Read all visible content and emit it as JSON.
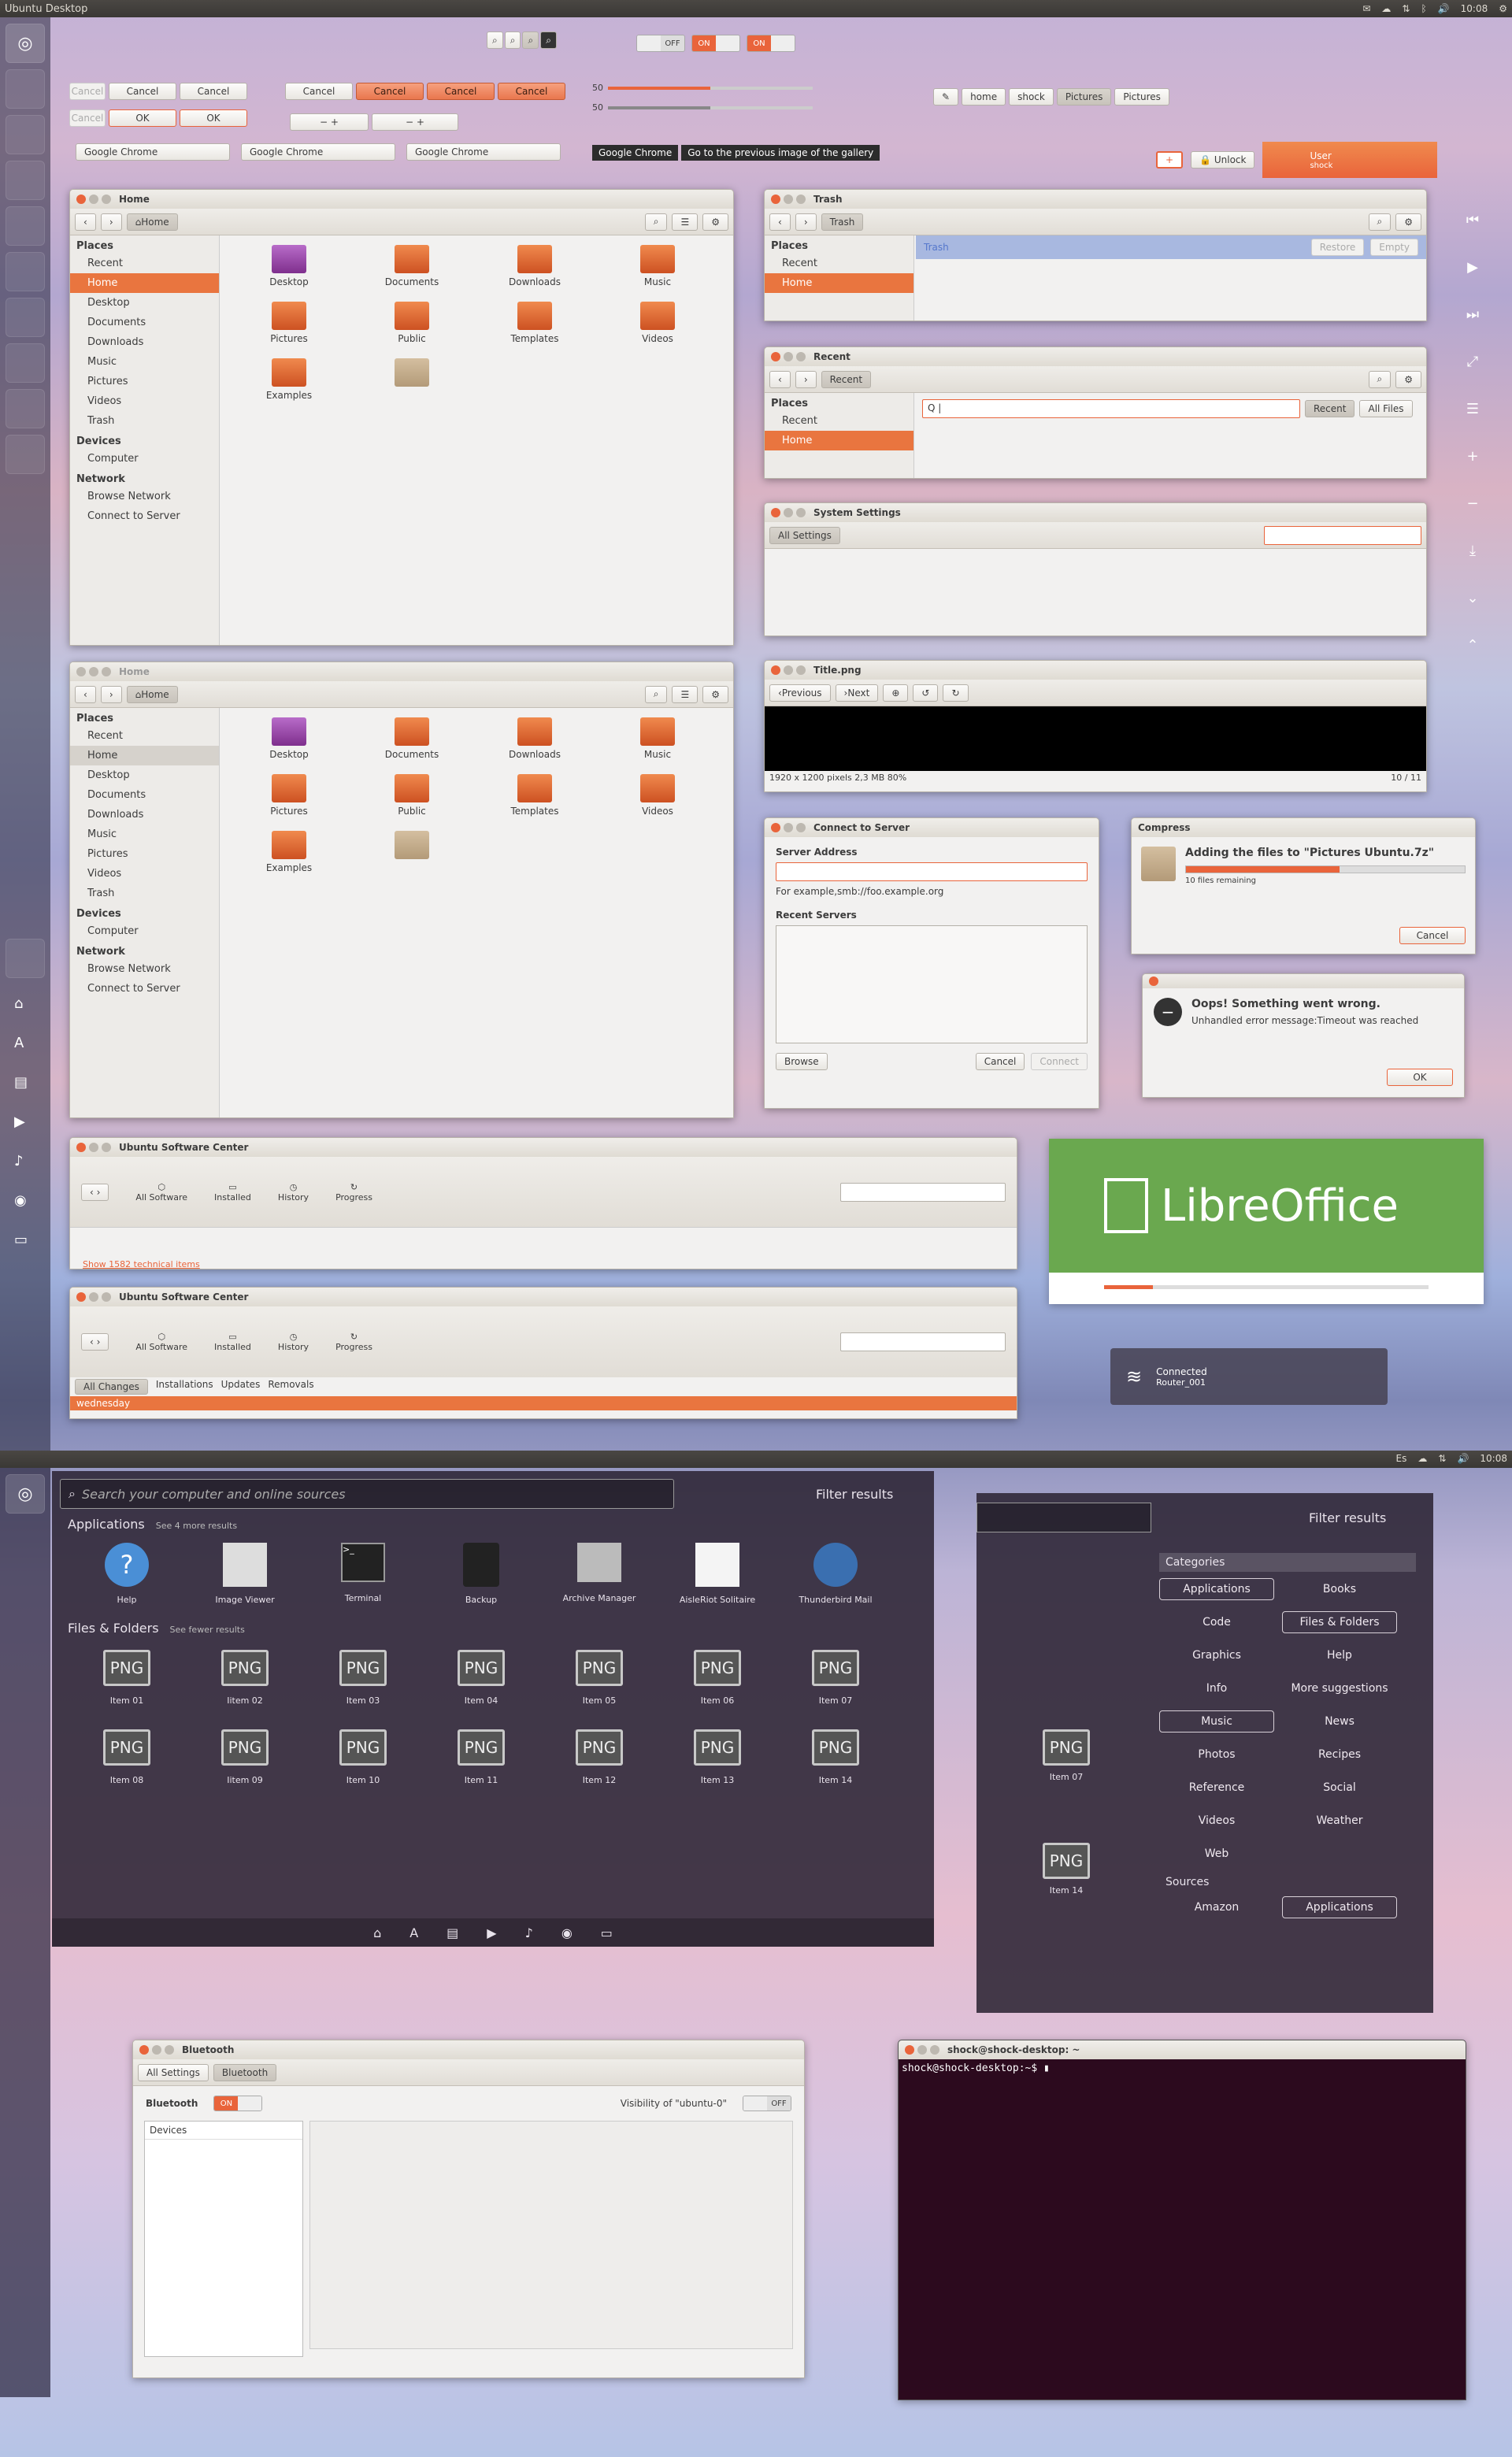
{
  "topbar": {
    "title": "Ubuntu Desktop",
    "time": "10:08"
  },
  "widgets": {
    "cancel": "Cancel",
    "ok": "OK",
    "off": "OFF",
    "on": "ON",
    "slider_val": "50",
    "combo": "Google Chrome",
    "tooltip1": "Google Chrome",
    "tooltip2": "Go to the previous image of the gallery",
    "path_home": "home",
    "path_shock": "shock",
    "path_pictures": "Pictures",
    "path_pictures2": "Pictures",
    "unlock": "Unlock",
    "user": "User",
    "user_sub": "shock"
  },
  "files1": {
    "title": "Home",
    "path": "Home",
    "places_h": "Places",
    "devices_h": "Devices",
    "network_h": "Network",
    "places": [
      "Recent",
      "Home",
      "Desktop",
      "Documents",
      "Downloads",
      "Music",
      "Pictures",
      "Videos",
      "Trash"
    ],
    "devices": [
      "Computer"
    ],
    "network": [
      "Browse Network",
      "Connect to Server"
    ],
    "items": [
      "Desktop",
      "Documents",
      "Downloads",
      "Music",
      "Pictures",
      "Public",
      "Templates",
      "Videos",
      "Examples",
      ""
    ]
  },
  "files2": {
    "title": "Home",
    "path": "Home"
  },
  "trash": {
    "title": "Trash",
    "path": "Trash",
    "places_h": "Places",
    "recent": "Recent",
    "home": "Home",
    "label": "Trash",
    "restore": "Restore",
    "empty": "Empty"
  },
  "recent": {
    "title": "Recent",
    "path": "Recent",
    "places_h": "Places",
    "recent": "Recent",
    "home": "Home",
    "search": "Q |",
    "tab_recent": "Recent",
    "tab_all": "All Files"
  },
  "settings": {
    "title": "System Settings",
    "all": "All Settings"
  },
  "image": {
    "title": "Title.png",
    "prev": "Previous",
    "next": "Next",
    "status": "1920 x 1200 pixels 2,3 MB   80%",
    "counter": "10 / 11"
  },
  "connect": {
    "title": "Connect to Server",
    "addr_label": "Server Address",
    "hint": "For example,smb://foo.example.org",
    "recent_label": "Recent Servers",
    "browse": "Browse",
    "cancel": "Cancel",
    "connect": "Connect"
  },
  "compress": {
    "title": "Compress",
    "msg": "Adding the files to \"Pictures Ubuntu.7z\"",
    "remaining": "10 files remaining",
    "cancel": "Cancel",
    "progress": 0.55
  },
  "error": {
    "title": "Oops! Something went wrong.",
    "msg": "Unhandled error message:Timeout was reached",
    "ok": "OK"
  },
  "usc1": {
    "title": "Ubuntu Software Center",
    "all": "All Software",
    "installed": "Installed",
    "history": "History",
    "progress": "Progress",
    "link": "Show 1582 technical items"
  },
  "usc2": {
    "title": "Ubuntu Software Center",
    "all": "All Software",
    "installed": "Installed",
    "history": "History",
    "progress": "Progress",
    "tabs": [
      "All Changes",
      "Installations",
      "Updates",
      "Removals"
    ],
    "day": "wednesday"
  },
  "libre": {
    "brand": "LibreOffice",
    "progress": 0.15
  },
  "net": {
    "title": "Connected",
    "sub": "Router_001"
  },
  "dash": {
    "search_placeholder": "Search your computer and online sources",
    "filter": "Filter results",
    "apps_h": "Applications",
    "apps_more": "See 4 more results",
    "apps": [
      "Help",
      "Image Viewer",
      "Terminal",
      "Backup",
      "Archive Manager",
      "AisleRiot Solitaire",
      "Thunderbird Mail"
    ],
    "files_h": "Files & Folders",
    "files_more": "See fewer results",
    "png": "PNG",
    "items1": [
      "Item 01",
      "Iitem 02",
      "Item 03",
      "Item 04",
      "Item 05",
      "Item 06",
      "Item 07"
    ],
    "items2": [
      "Item 08",
      "Iitem 09",
      "Item 10",
      "Item 11",
      "Item 12",
      "Item 13",
      "Item 14"
    ]
  },
  "filter": {
    "title": "Filter results",
    "cat_h": "Categories",
    "cats": [
      "Applications",
      "Books",
      "Code",
      "Files & Folders",
      "Graphics",
      "Help",
      "Info",
      "More suggestions",
      "Music",
      "News",
      "Photos",
      "Recipes",
      "Reference",
      "Social",
      "Videos",
      "Weather",
      "Web"
    ],
    "src_h": "Sources",
    "srcs": [
      "Amazon",
      "Applications"
    ],
    "item07": "Item 07",
    "item14": "Item 14"
  },
  "bt": {
    "title": "Bluetooth",
    "crumb1": "All Settings",
    "crumb2": "Bluetooth",
    "label": "Bluetooth",
    "on": "ON",
    "vis": "Visibility of \"ubuntu-0\"",
    "off": "OFF",
    "devices": "Devices"
  },
  "term": {
    "title": "shock@shock-desktop: ~",
    "prompt": "shock@shock-desktop:~$"
  },
  "topbar2": {
    "time": "10:08",
    "kb": "Es"
  }
}
